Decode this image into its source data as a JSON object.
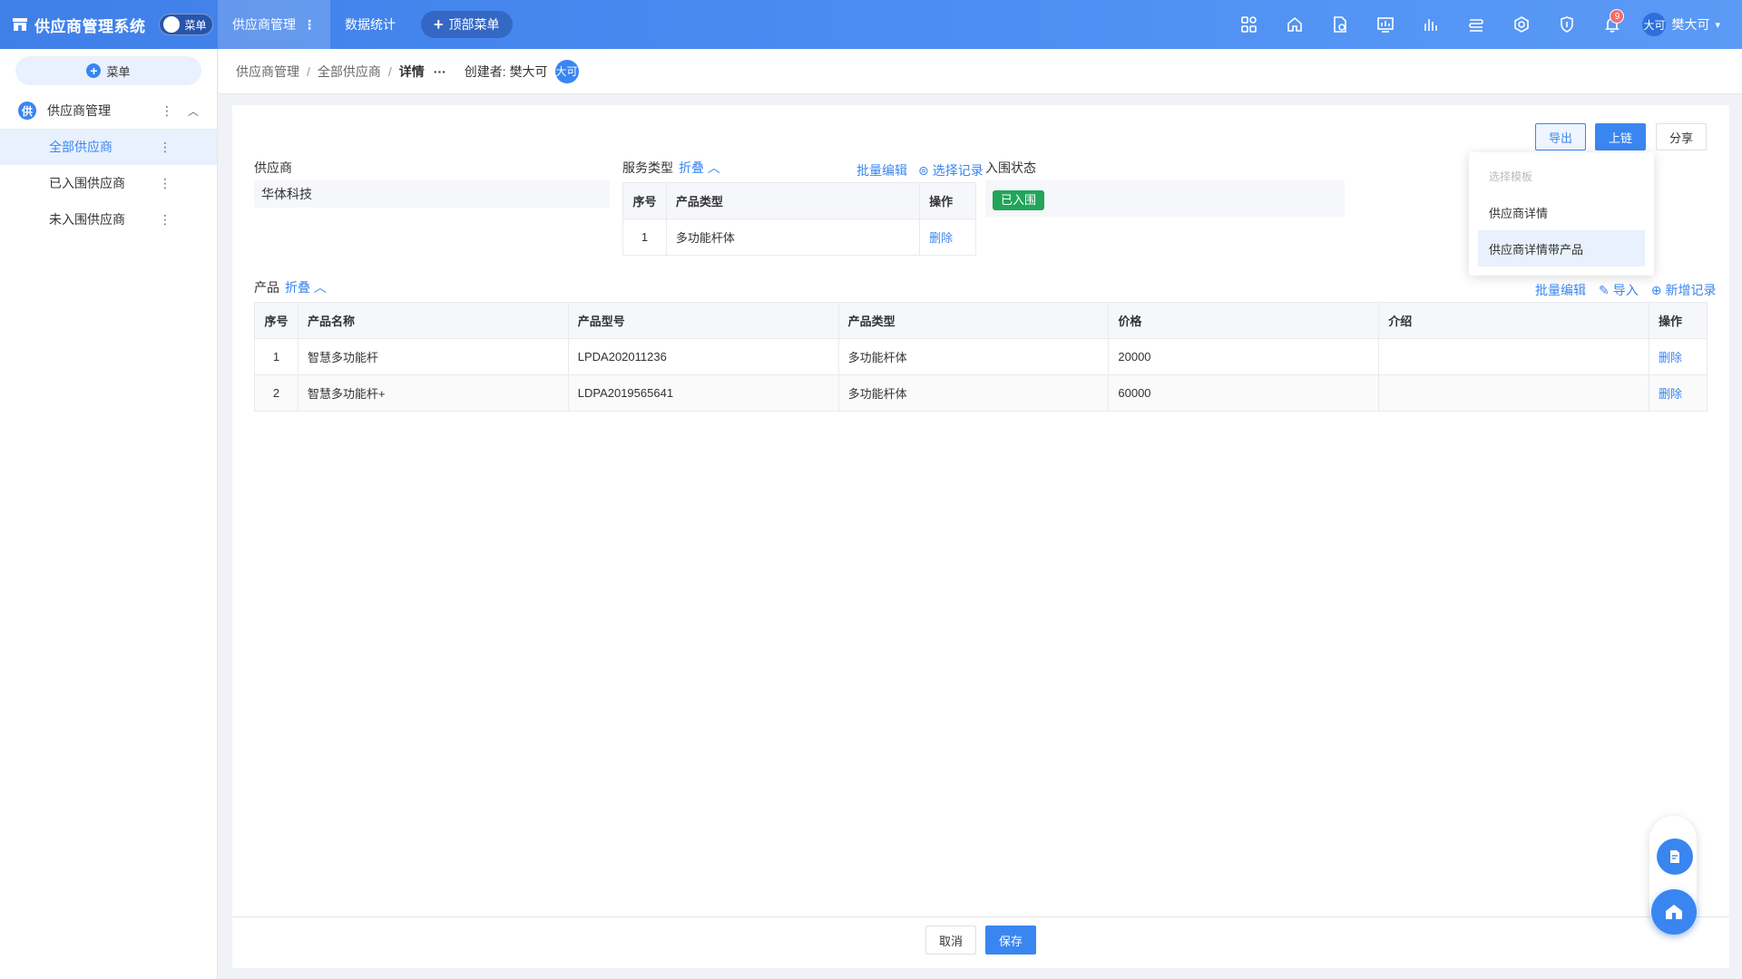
{
  "app": {
    "title": "供应商管理系统",
    "menu_toggle_label": "菜单",
    "top_tabs": [
      {
        "label": "供应商管理"
      },
      {
        "label": "数据统计"
      }
    ],
    "add_top_menu_label": "顶部菜单",
    "notification_count": "9",
    "user": {
      "avatar_text": "大可",
      "name": "樊大可"
    }
  },
  "sidebar": {
    "menu_button_label": "菜单",
    "group": {
      "icon_text": "供",
      "label": "供应商管理"
    },
    "items": [
      {
        "label": "全部供应商",
        "active": true
      },
      {
        "label": "已入围供应商",
        "active": false
      },
      {
        "label": "未入围供应商",
        "active": false
      }
    ]
  },
  "breadcrumb": {
    "items": [
      "供应商管理",
      "全部供应商",
      "详情"
    ],
    "ellipsis": "···",
    "creator_label": "创建者:",
    "creator_name": "樊大可",
    "creator_avatar": "大可"
  },
  "toolbar": {
    "export_label": "导出",
    "chain_label": "上链",
    "share_label": "分享"
  },
  "export_dropdown": {
    "header": "选择模板",
    "options": [
      "供应商详情",
      "供应商详情带产品"
    ]
  },
  "form": {
    "supplier_label": "供应商",
    "supplier_value": "华体科技",
    "service_type_label": "服务类型",
    "fold_label": "折叠",
    "batch_edit_label": "批量编辑",
    "select_record_label": "选择记录",
    "status_label": "入围状态",
    "status_value": "已入围"
  },
  "service_table": {
    "headers": [
      "序号",
      "产品类型",
      "操作"
    ],
    "rows": [
      {
        "no": "1",
        "type": "多功能杆体",
        "action": "删除"
      }
    ]
  },
  "products": {
    "label": "产品",
    "fold_label": "折叠",
    "batch_edit_label": "批量编辑",
    "import_label": "导入",
    "add_record_label": "新增记录",
    "headers": [
      "序号",
      "产品名称",
      "产品型号",
      "产品类型",
      "价格",
      "介绍",
      "操作"
    ],
    "rows": [
      {
        "no": "1",
        "name": "智慧多功能杆",
        "model": "LPDA202011236",
        "type": "多功能杆体",
        "price": "20000",
        "intro": "",
        "action": "删除"
      },
      {
        "no": "2",
        "name": "智慧多功能杆+",
        "model": "LDPA2019565641",
        "type": "多功能杆体",
        "price": "60000",
        "intro": "",
        "action": "删除"
      }
    ]
  },
  "footer": {
    "cancel_label": "取消",
    "save_label": "保存"
  },
  "colors": {
    "primary": "#3a86f0",
    "success_tag": "#21a559",
    "topbar": "#4a8cf2"
  },
  "icons": [
    "store-icon",
    "apps-icon",
    "home-icon",
    "document-settings-icon",
    "dashboard-icon",
    "bar-chart-icon",
    "list-icon",
    "network-icon",
    "shield-icon",
    "bell-icon",
    "chevron-down-icon",
    "edit-icon",
    "home-float-icon"
  ]
}
